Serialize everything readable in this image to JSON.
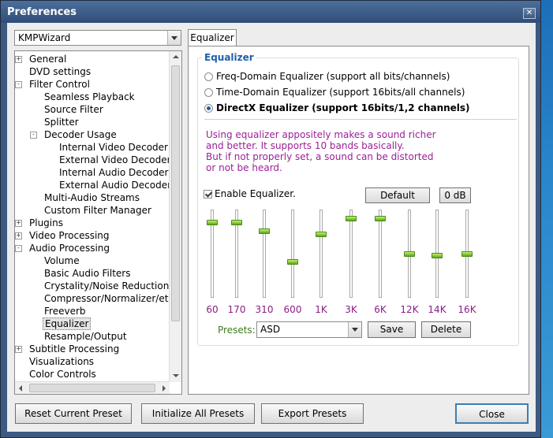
{
  "window": {
    "title": "Preferences",
    "close_icon": "close-icon"
  },
  "left": {
    "profile_combo": "KMPWizard",
    "tree": [
      {
        "label": "General",
        "level": 0,
        "expander": "+"
      },
      {
        "label": "DVD settings",
        "level": 0,
        "expander": ""
      },
      {
        "label": "Filter Control",
        "level": 0,
        "expander": "-"
      },
      {
        "label": "Seamless Playback",
        "level": 1,
        "expander": ""
      },
      {
        "label": "Source Filter",
        "level": 1,
        "expander": ""
      },
      {
        "label": "Splitter",
        "level": 1,
        "expander": ""
      },
      {
        "label": "Decoder Usage",
        "level": 1,
        "expander": "-"
      },
      {
        "label": "Internal Video Decoder",
        "level": 2,
        "expander": ""
      },
      {
        "label": "External Video Decoder",
        "level": 2,
        "expander": ""
      },
      {
        "label": "Internal Audio Decoder",
        "level": 2,
        "expander": ""
      },
      {
        "label": "External Audio Decoder",
        "level": 2,
        "expander": ""
      },
      {
        "label": "Multi-Audio Streams",
        "level": 1,
        "expander": ""
      },
      {
        "label": "Custom Filter Manager",
        "level": 1,
        "expander": ""
      },
      {
        "label": "Plugins",
        "level": 0,
        "expander": "+"
      },
      {
        "label": "Video Processing",
        "level": 0,
        "expander": "+"
      },
      {
        "label": "Audio Processing",
        "level": 0,
        "expander": "-"
      },
      {
        "label": "Volume",
        "level": 1,
        "expander": ""
      },
      {
        "label": "Basic Audio Filters",
        "level": 1,
        "expander": ""
      },
      {
        "label": "Crystality/Noise Reduction",
        "level": 1,
        "expander": ""
      },
      {
        "label": "Compressor/Normalizer/etc",
        "level": 1,
        "expander": ""
      },
      {
        "label": "Freeverb",
        "level": 1,
        "expander": ""
      },
      {
        "label": "Equalizer",
        "level": 1,
        "expander": "",
        "selected": true
      },
      {
        "label": "Resample/Output",
        "level": 1,
        "expander": ""
      },
      {
        "label": "Subtitle Processing",
        "level": 0,
        "expander": "+"
      },
      {
        "label": "Visualizations",
        "level": 0,
        "expander": ""
      },
      {
        "label": "Color Controls",
        "level": 0,
        "expander": ""
      }
    ]
  },
  "right": {
    "tab_label": "Equalizer",
    "group_title": "Equalizer",
    "radios": [
      {
        "label": "Freq-Domain Equalizer (support all bits/channels)",
        "checked": false
      },
      {
        "label": "Time-Domain Equalizer (support 16bits/all channels)",
        "checked": false
      },
      {
        "label": "DirectX Equalizer (support 16bits/1,2 channels)",
        "checked": true
      }
    ],
    "message_lines": [
      "Using equalizer appositely makes a sound richer",
      "and better. It supports 10 bands basically.",
      "But if not properly set, a sound can be distorted",
      "or not be heard."
    ],
    "enable_label": "Enable Equalizer.",
    "enable_checked": true,
    "default_button": "Default",
    "zero_db_button": "0 dB",
    "bands": [
      {
        "freq": "60",
        "level": 0.88
      },
      {
        "freq": "170",
        "level": 0.88
      },
      {
        "freq": "310",
        "level": 0.77
      },
      {
        "freq": "600",
        "level": 0.4
      },
      {
        "freq": "1K",
        "level": 0.73
      },
      {
        "freq": "3K",
        "level": 0.92
      },
      {
        "freq": "6K",
        "level": 0.92
      },
      {
        "freq": "12K",
        "level": 0.5
      },
      {
        "freq": "14K",
        "level": 0.48
      },
      {
        "freq": "16K",
        "level": 0.5
      }
    ],
    "presets_label": "Presets:",
    "preset_value": "ASD",
    "save_button": "Save",
    "delete_button": "Delete"
  },
  "footer": {
    "reset_button": "Reset Current Preset",
    "init_button": "Initialize All Presets",
    "export_button": "Export Presets",
    "close_button": "Close"
  },
  "colors": {
    "accent": "#1f5faa",
    "message": "#9b2197",
    "freq_label": "#8a1e84",
    "presets_label": "#3f7d1f",
    "knob": "#7cc52e"
  }
}
